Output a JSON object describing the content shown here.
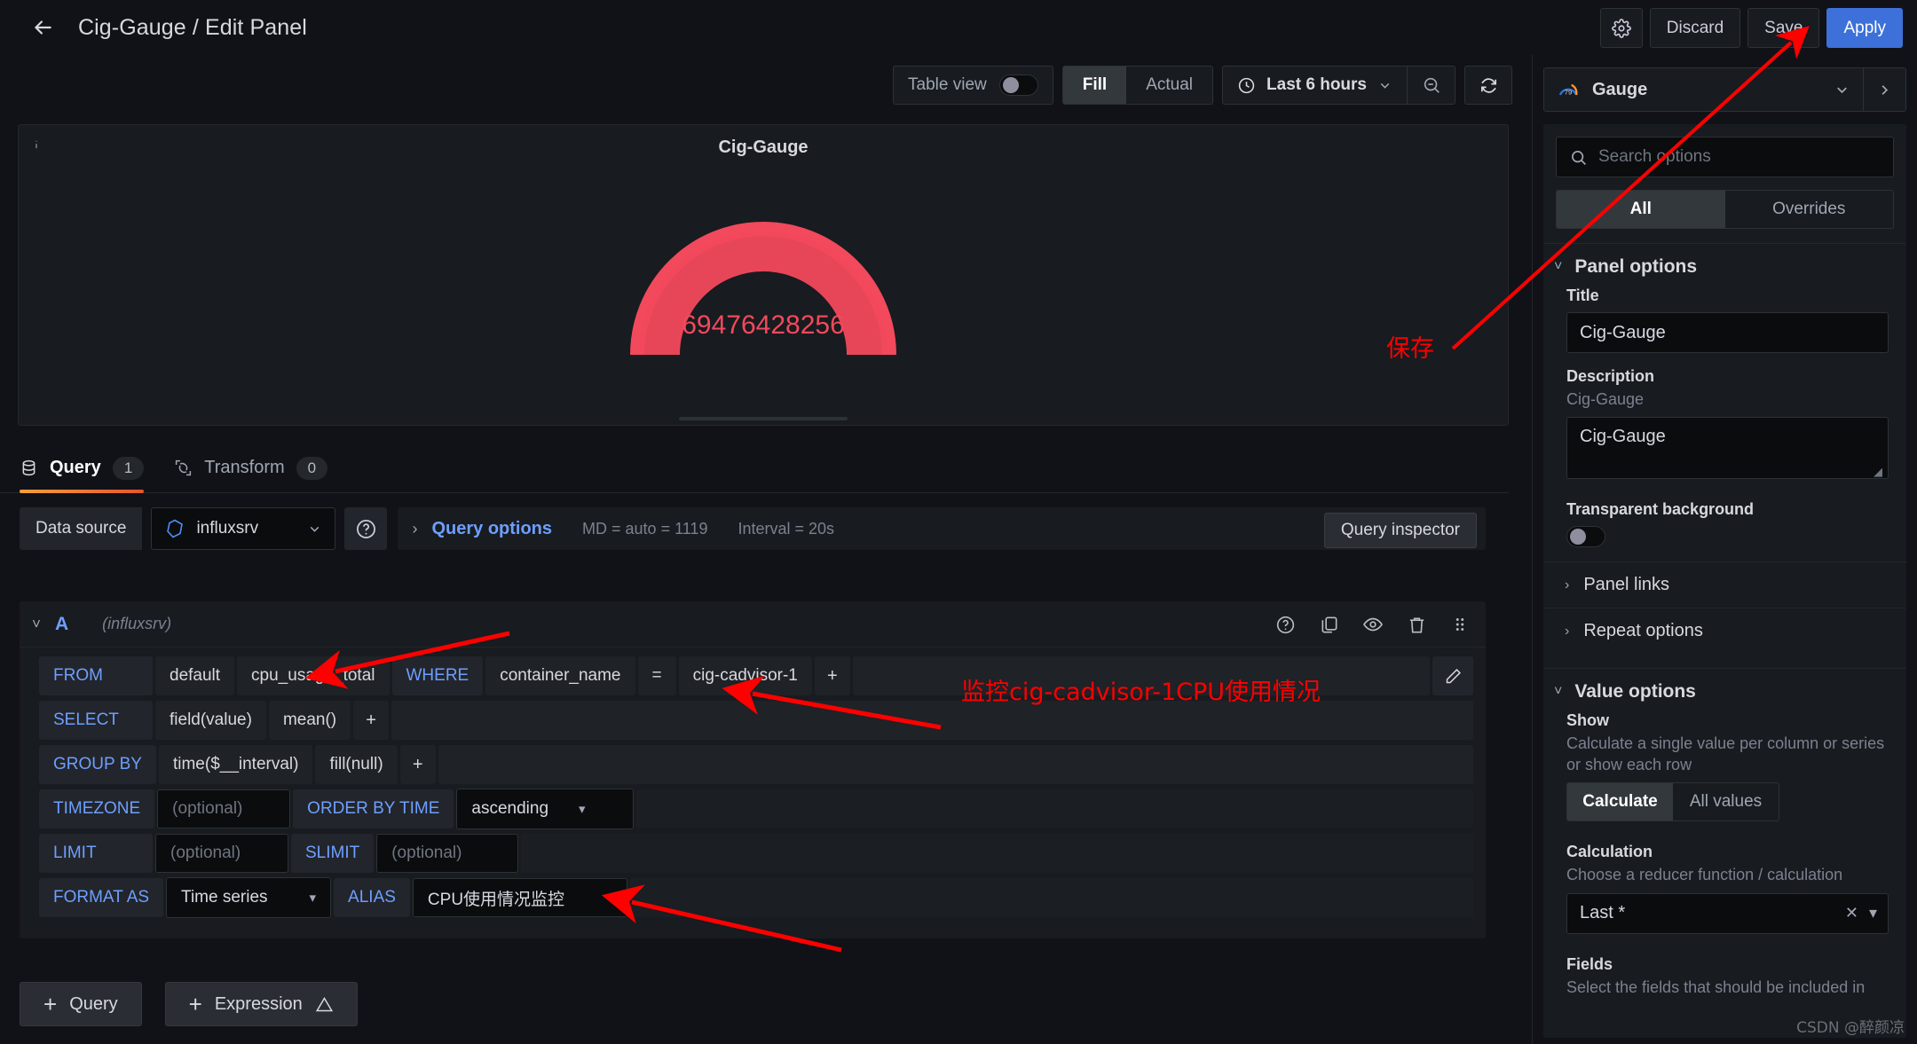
{
  "header": {
    "back_icon": "arrow-left-icon",
    "breadcrumb_dashboard": "Cig-Gauge",
    "breadcrumb_sep": " / ",
    "breadcrumb_page": "Edit Panel",
    "settings_icon": "gear-icon",
    "discard_label": "Discard",
    "save_label": "Save",
    "apply_label": "Apply"
  },
  "toolbar": {
    "table_view_label": "Table view",
    "table_view_on": false,
    "fill_label": "Fill",
    "actual_label": "Actual",
    "fill_active": true,
    "clock_icon": "clock-icon",
    "time_range": "Last 6 hours",
    "zoom_out_icon": "zoom-out-icon",
    "refresh_icon": "refresh-icon"
  },
  "panel": {
    "info_icon": "info-icon",
    "title": "Cig-Gauge",
    "gauge_value": "69476428256",
    "gauge_color": "#f2495c",
    "gauge_fill_percent": 100
  },
  "query_tabs": [
    {
      "label": "Query",
      "badge": "1",
      "icon": "database-icon",
      "active": true
    },
    {
      "label": "Transform",
      "badge": "0",
      "icon": "transform-icon",
      "active": false
    }
  ],
  "datasource_row": {
    "label": "Data source",
    "name": "influxsrv",
    "ds_icon": "influxdb-icon",
    "help_icon": "help-circle-icon",
    "query_options_label": "Query options",
    "md_text": "MD = auto = 1119",
    "interval_text": "Interval = 20s",
    "query_inspector_label": "Query inspector"
  },
  "query_editor": {
    "ref_id": "A",
    "ds_name": "(influxsrv)",
    "actions": [
      "help-circle-icon",
      "duplicate-icon",
      "eye-icon",
      "trash-icon",
      "drag-handle-icon"
    ],
    "rows": {
      "from": {
        "key": "FROM",
        "policy": "default",
        "measurement": "cpu_usage_total",
        "where_key": "WHERE",
        "tag": "container_name",
        "operator": "=",
        "value": "cig-cadvisor-1",
        "plus": "+",
        "pencil_icon": "pencil-icon"
      },
      "select": {
        "key": "SELECT",
        "field": "field(value)",
        "func": "mean()",
        "plus": "+"
      },
      "group_by": {
        "key": "GROUP BY",
        "time": "time($__interval)",
        "fill": "fill(null)",
        "plus": "+"
      },
      "timezone": {
        "key": "TIMEZONE",
        "value_placeholder": "(optional)",
        "order_key": "ORDER BY TIME",
        "order_value": "ascending"
      },
      "limit": {
        "key": "LIMIT",
        "value_placeholder": "(optional)",
        "slimit_key": "SLIMIT",
        "slimit_placeholder": "(optional)"
      },
      "format_as": {
        "key": "FORMAT AS",
        "value": "Time series",
        "alias_key": "ALIAS",
        "alias_value": "CPU使用情况监控"
      }
    }
  },
  "bottom_buttons": {
    "add_query": "Query",
    "add_expression": "Expression",
    "expression_warn_icon": "warning-triangle-icon",
    "plus": "+"
  },
  "sidebar": {
    "viz_icon": "gauge-icon",
    "viz_name": "Gauge",
    "viz_chevron": "chevron-down-icon",
    "viz_arrow": "chevron-right-icon",
    "search_icon": "search-icon",
    "search_placeholder": "Search options",
    "tab_all": "All",
    "tab_overrides": "Overrides",
    "panel_options": {
      "section_title": "Panel options",
      "title_label": "Title",
      "title_value": "Cig-Gauge",
      "description_label": "Description",
      "description_desc": "Cig-Gauge",
      "description_value": "Cig-Gauge",
      "transparent_label": "Transparent background",
      "transparent_on": false,
      "panel_links": "Panel links",
      "repeat_options": "Repeat options"
    },
    "value_options": {
      "section_title": "Value options",
      "show_label": "Show",
      "show_desc": "Calculate a single value per column or series or show each row",
      "calculate_label": "Calculate",
      "all_values_label": "All values",
      "calculation_label": "Calculation",
      "calculation_desc": "Choose a reducer function / calculation",
      "calculation_value": "Last *",
      "clear_icon": "close-icon",
      "dropdown_icon": "chevron-down-icon",
      "fields_label": "Fields",
      "fields_desc": "Select the fields that should be included in"
    }
  },
  "annotations": [
    {
      "text": "保存",
      "color": "#ff0000"
    },
    {
      "text": "监控cig-cadvisor-1CPU使用情况",
      "color": "#ff0000"
    }
  ],
  "watermark": "CSDN @醉颜凉"
}
